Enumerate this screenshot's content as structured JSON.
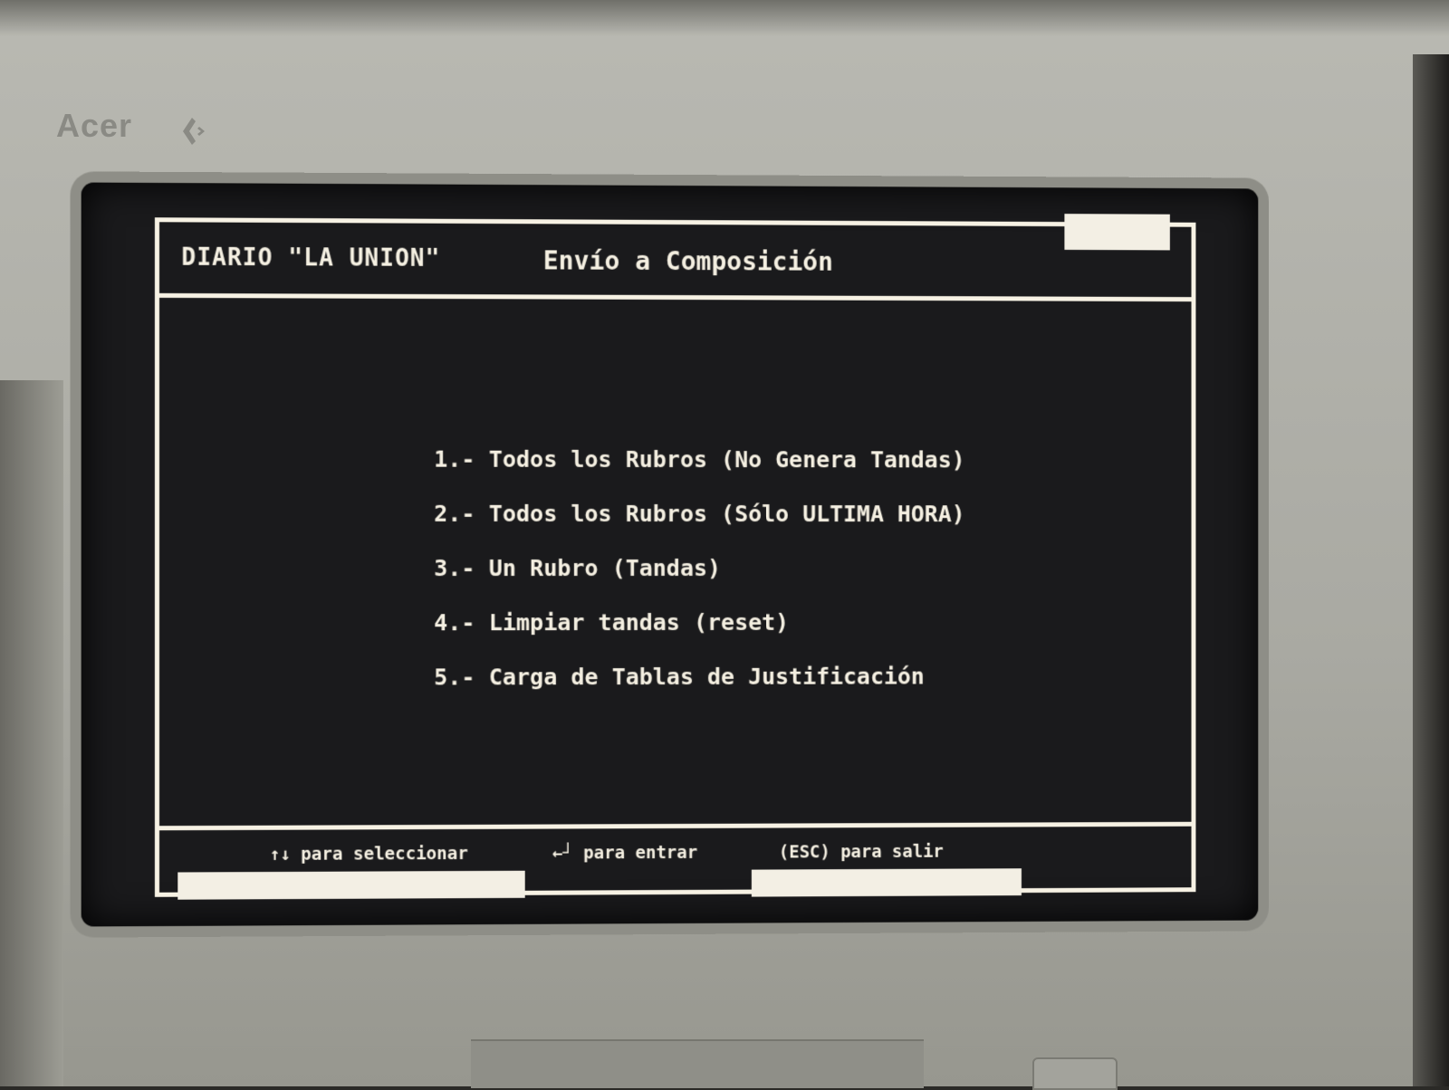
{
  "monitor": {
    "brand": "Acer"
  },
  "header": {
    "app_title": "DIARIO \"LA UNION\"",
    "screen_title": "Envío a Composición"
  },
  "menu": {
    "items": [
      {
        "label": "1.- Todos los Rubros (No Genera Tandas)"
      },
      {
        "label": "2.- Todos los Rubros (Sólo ULTIMA HORA)"
      },
      {
        "label": "3.- Un Rubro (Tandas)"
      },
      {
        "label": "4.- Limpiar tandas (reset)"
      },
      {
        "label": "5.- Carga de Tablas de Justificación"
      }
    ]
  },
  "footer": {
    "select_hint": "↑↓ para seleccionar",
    "enter_hint": "←┘ para entrar",
    "exit_hint": "(ESC) para salir"
  },
  "colors": {
    "screen_text": "#f5f0e2",
    "screen_bg": "#1a1a1c",
    "bezel": "#a9a9a2"
  }
}
